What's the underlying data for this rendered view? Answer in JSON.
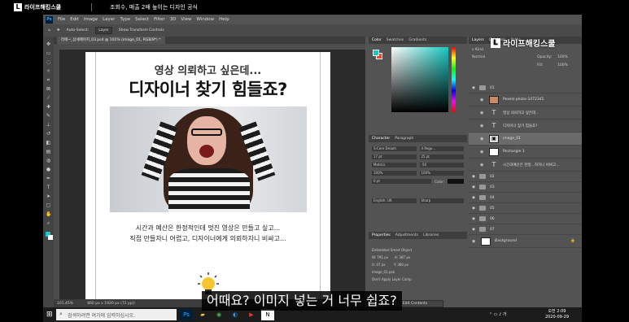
{
  "video_header": {
    "brand": "라이프해킹스쿨",
    "slogan": "조회수, 매출 2배 높이는 디자인 공식"
  },
  "watermark": {
    "brand": "라이프해킹스쿨"
  },
  "photoshop": {
    "menu": [
      "File",
      "Edit",
      "Image",
      "Layer",
      "Type",
      "Select",
      "Filter",
      "3D",
      "View",
      "Window",
      "Help"
    ],
    "options": {
      "auto_select": "Auto-Select:",
      "auto_select_value": "Layer",
      "transform": "Show Transform Controls"
    },
    "doc_tab": "라에~_상세페이지_03.psd @ 101% (image_01, RGB/8*) *",
    "status": {
      "zoom": "101.45%",
      "info": "860 px x 1920 px (72 ppi)"
    }
  },
  "canvas": {
    "heading": "영상 의뢰하고 싶은데...",
    "title": "디자이너 찾기 힘들죠?",
    "body_line1": "시간과 예산은 한정적인데 멋진 영상은 만들고 싶고...",
    "body_line2": "직접 만들자니 어렵고, 디자이너에게 의뢰하자니 비싸고..."
  },
  "panels": {
    "color_tabs": [
      "Color",
      "Swatches",
      "Gradients"
    ],
    "character_tabs": [
      "Character",
      "Paragraph"
    ],
    "character": {
      "font": "S-Core Dream",
      "weight": "4 Regu...",
      "size": "17 pt",
      "leading": "25 pt",
      "kerning": "Metrics",
      "tracking": "-50",
      "scale_v": "100%",
      "scale_h": "100%",
      "baseline": "0 pt",
      "color_label": "Color:",
      "language": "English: UK",
      "aa": "Sharp"
    },
    "properties_tabs": [
      "Properties",
      "Adjustments",
      "Libraries"
    ],
    "properties": {
      "type": "Embedded Smart Object",
      "w": "W: 791 px",
      "h": "H: 387 px",
      "x": "X: 47 px",
      "y": "Y: 380 px",
      "file": "image_01.psb",
      "comp": "Don't Apply Layer Comp",
      "edit_button": "Edit Contents"
    },
    "layers_tabs": [
      "Layers",
      "Channels",
      "Paths"
    ],
    "layers_filter": "Kind",
    "blend_mode": "Normal",
    "opacity_label": "Opacity:",
    "opacity": "100%",
    "fill_label": "Fill:",
    "fill": "100%",
    "layers": [
      {
        "name": "01",
        "kind": "group"
      },
      {
        "name": "Pexels-photo-1472345",
        "kind": "image"
      },
      {
        "name": "영상 의뢰하고 싶은데...",
        "kind": "text"
      },
      {
        "name": "디자이너 찾기 힘들죠?",
        "kind": "text"
      },
      {
        "name": "image_01",
        "kind": "smart",
        "selected": true
      },
      {
        "name": "Rectangle 1",
        "kind": "image"
      },
      {
        "name": "시간과예산은 한정...하자니 비싸고...",
        "kind": "text"
      },
      {
        "name": "02",
        "kind": "group"
      },
      {
        "name": "03",
        "kind": "group"
      },
      {
        "name": "04",
        "kind": "group"
      },
      {
        "name": "05",
        "kind": "group"
      },
      {
        "name": "06",
        "kind": "group"
      },
      {
        "name": "07",
        "kind": "group"
      },
      {
        "name": "Background",
        "kind": "image"
      }
    ]
  },
  "subtitle": "어때요? 이미지 넣는 거 너무 쉽죠?",
  "taskbar": {
    "search_placeholder": "검색하려면 여기에 입력하십시오.",
    "apps": [
      "Ps",
      "Explorer",
      "Chrome",
      "Edge",
      "Media",
      "N"
    ],
    "time": "오전 2:09",
    "date": "2020-09-29"
  },
  "colors": {
    "accent_teal": "#19c8c0",
    "ps_bg": "#535353",
    "guide": "#7fd6ff"
  }
}
